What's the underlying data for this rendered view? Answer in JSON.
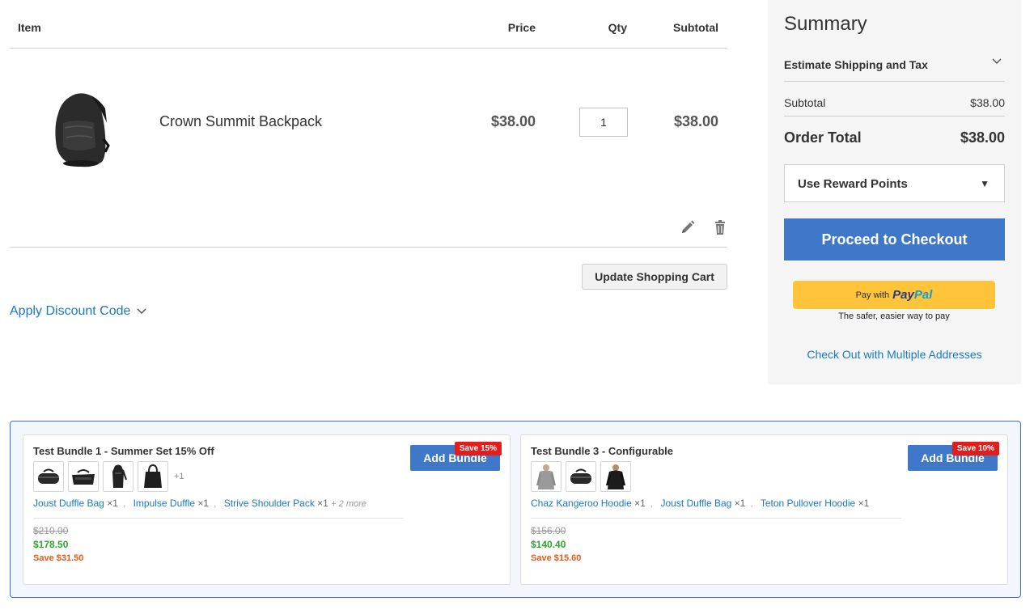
{
  "cart": {
    "headers": {
      "item": "Item",
      "price": "Price",
      "qty": "Qty",
      "subtotal": "Subtotal"
    },
    "row": {
      "name": "Crown Summit Backpack",
      "price": "$38.00",
      "qty": "1",
      "subtotal": "$38.00",
      "image_icon": "backpack-image"
    },
    "update_label": "Update Shopping Cart",
    "discount_label": "Apply Discount Code"
  },
  "summary": {
    "title": "Summary",
    "estimate_label": "Estimate Shipping and Tax",
    "subtotal_label": "Subtotal",
    "subtotal_value": "$38.00",
    "total_label": "Order Total",
    "total_value": "$38.00",
    "reward_label": "Use Reward Points",
    "checkout_label": "Proceed to Checkout",
    "paypal_pay_with": "Pay with",
    "paypal_brand_1": "Pay",
    "paypal_brand_2": "Pal",
    "paypal_tagline": "The safer, easier way to pay",
    "multi_address_label": "Check Out with Multiple Addresses"
  },
  "bundles": [
    {
      "title": "Test Bundle 1 - Summer Set 15% Off",
      "more_count": "+1",
      "items": [
        {
          "name": "Joust Duffle Bag",
          "qty": "×1"
        },
        {
          "name": "Impulse Duffle",
          "qty": "×1"
        },
        {
          "name": "Strive Shoulder Pack",
          "qty": "×1"
        }
      ],
      "more_label": "+ 2 more",
      "original_price": "$210.00",
      "price": "$178.50",
      "save": "Save $31.50",
      "badge": "Save 15%",
      "button": "Add Bundle"
    },
    {
      "title": "Test Bundle 3 - Configurable",
      "items": [
        {
          "name": "Chaz Kangeroo Hoodie",
          "qty": "×1"
        },
        {
          "name": "Joust Duffle Bag",
          "qty": "×1"
        },
        {
          "name": "Teton Pullover Hoodie",
          "qty": "×1"
        }
      ],
      "original_price": "$156.00",
      "price": "$140.40",
      "save": "Save $15.60",
      "badge": "Save 10%",
      "button": "Add Bundle"
    }
  ],
  "colors": {
    "primary_blue": "#3f78c9",
    "link_blue": "#1979c3",
    "summary_bg": "#f5f5f5",
    "paypal_yellow": "#ffc439",
    "save_red": "#e31c1c",
    "price_green": "#2fa52f",
    "save_orange": "#e55a16"
  }
}
